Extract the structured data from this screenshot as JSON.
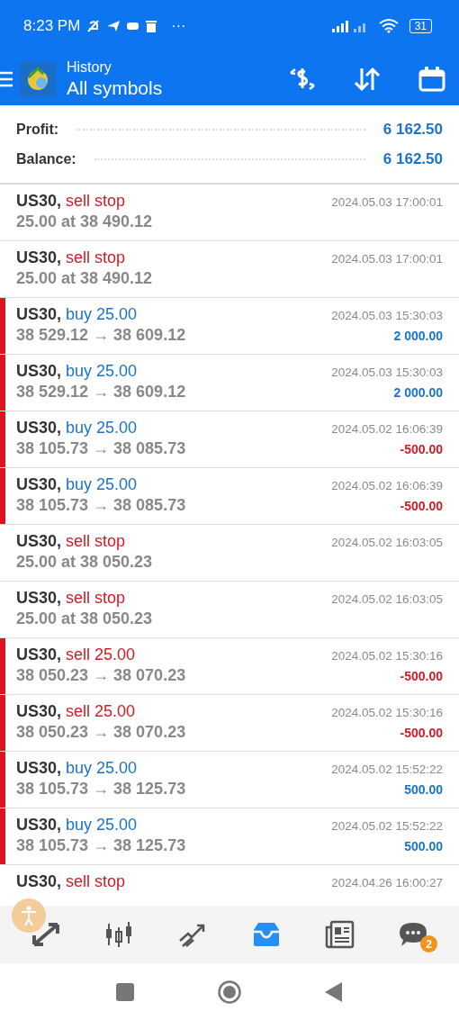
{
  "status_bar": {
    "time": "8:23 PM",
    "more": "···",
    "battery": "31"
  },
  "app_bar": {
    "title": "History",
    "subtitle": "All symbols"
  },
  "summary": [
    {
      "label": "Profit:",
      "value": "6 162.50"
    },
    {
      "label": "Balance:",
      "value": "6 162.50"
    }
  ],
  "rows": [
    {
      "kind": "order",
      "symbol": "US30,",
      "action": {
        "text": "sell stop",
        "kind": "sell"
      },
      "detail": "25.00 at 38 490.12",
      "time": "2024.05.03 17:00:01"
    },
    {
      "kind": "order",
      "symbol": "US30,",
      "action": {
        "text": "sell stop",
        "kind": "sell"
      },
      "detail": "25.00 at 38 490.12",
      "time": "2024.05.03 17:00:01"
    },
    {
      "kind": "deal",
      "symbol": "US30,",
      "action": {
        "text": "buy 25.00",
        "kind": "buy"
      },
      "detail": "38 529.12 → 38 609.12",
      "time": "2024.05.03 15:30:03",
      "profit": {
        "text": "2 000.00",
        "kind": "gain"
      }
    },
    {
      "kind": "deal",
      "symbol": "US30,",
      "action": {
        "text": "buy 25.00",
        "kind": "buy"
      },
      "detail": "38 529.12 → 38 609.12",
      "time": "2024.05.03 15:30:03",
      "profit": {
        "text": "2 000.00",
        "kind": "gain"
      }
    },
    {
      "kind": "deal",
      "symbol": "US30,",
      "action": {
        "text": "buy 25.00",
        "kind": "buy"
      },
      "detail": "38 105.73 → 38 085.73",
      "time": "2024.05.02 16:06:39",
      "profit": {
        "text": "-500.00",
        "kind": "loss"
      }
    },
    {
      "kind": "deal",
      "symbol": "US30,",
      "action": {
        "text": "buy 25.00",
        "kind": "buy"
      },
      "detail": "38 105.73 → 38 085.73",
      "time": "2024.05.02 16:06:39",
      "profit": {
        "text": "-500.00",
        "kind": "loss"
      }
    },
    {
      "kind": "order",
      "symbol": "US30,",
      "action": {
        "text": "sell stop",
        "kind": "sell"
      },
      "detail": "25.00 at 38 050.23",
      "time": "2024.05.02 16:03:05"
    },
    {
      "kind": "order",
      "symbol": "US30,",
      "action": {
        "text": "sell stop",
        "kind": "sell"
      },
      "detail": "25.00 at 38 050.23",
      "time": "2024.05.02 16:03:05"
    },
    {
      "kind": "deal",
      "symbol": "US30,",
      "action": {
        "text": "sell 25.00",
        "kind": "sell"
      },
      "detail": "38 050.23 → 38 070.23",
      "time": "2024.05.02 15:30:16",
      "profit": {
        "text": "-500.00",
        "kind": "loss"
      }
    },
    {
      "kind": "deal",
      "symbol": "US30,",
      "action": {
        "text": "sell 25.00",
        "kind": "sell"
      },
      "detail": "38 050.23 → 38 070.23",
      "time": "2024.05.02 15:30:16",
      "profit": {
        "text": "-500.00",
        "kind": "loss"
      }
    },
    {
      "kind": "deal",
      "symbol": "US30,",
      "action": {
        "text": "buy 25.00",
        "kind": "buy"
      },
      "detail": "38 105.73 → 38 125.73",
      "time": "2024.05.02 15:52:22",
      "profit": {
        "text": "500.00",
        "kind": "gain"
      }
    },
    {
      "kind": "deal",
      "symbol": "US30,",
      "action": {
        "text": "buy 25.00",
        "kind": "buy"
      },
      "detail": "38 105.73 → 38 125.73",
      "time": "2024.05.02 15:52:22",
      "profit": {
        "text": "500.00",
        "kind": "gain"
      }
    },
    {
      "kind": "order",
      "symbol": "US30,",
      "action": {
        "text": "sell stop",
        "kind": "sell"
      },
      "time": "2024.04.26 16:00:27"
    }
  ],
  "nav": [
    {
      "kind": "quotes",
      "selected": false
    },
    {
      "kind": "chart",
      "selected": false
    },
    {
      "kind": "trade",
      "selected": false
    },
    {
      "kind": "history",
      "selected": true
    },
    {
      "kind": "news",
      "selected": false
    },
    {
      "kind": "chat",
      "selected": false,
      "badge": "2"
    }
  ]
}
